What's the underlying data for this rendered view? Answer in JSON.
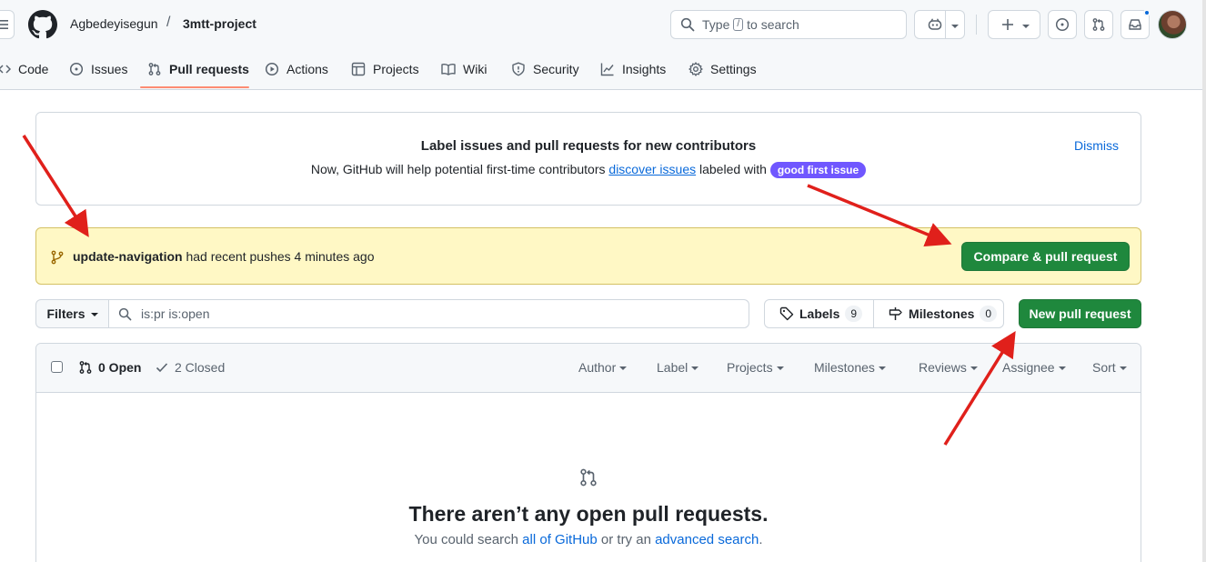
{
  "header": {
    "owner": "Agbedeyisegun",
    "separator": "/",
    "repo": "3mtt-project",
    "search_prefix": "Type",
    "search_key": "/",
    "search_suffix": "to search"
  },
  "nav": {
    "items": [
      {
        "label": "Code",
        "icon": "code-icon"
      },
      {
        "label": "Issues",
        "icon": "issue-opened-icon"
      },
      {
        "label": "Pull requests",
        "icon": "git-pull-request-icon",
        "active": true
      },
      {
        "label": "Actions",
        "icon": "play-icon"
      },
      {
        "label": "Projects",
        "icon": "table-icon"
      },
      {
        "label": "Wiki",
        "icon": "book-icon"
      },
      {
        "label": "Security",
        "icon": "shield-icon"
      },
      {
        "label": "Insights",
        "icon": "graph-icon"
      },
      {
        "label": "Settings",
        "icon": "gear-icon"
      }
    ]
  },
  "contrib_banner": {
    "title": "Label issues and pull requests for new contributors",
    "text_before": "Now, GitHub will help potential first-time contributors",
    "link": "discover issues",
    "text_after": "labeled with",
    "label": "good first issue",
    "label_color": "#7057ff",
    "dismiss": "Dismiss"
  },
  "push_banner": {
    "branch": "update-navigation",
    "text": "had recent pushes 4 minutes ago",
    "compare_button": "Compare & pull request"
  },
  "toolbar": {
    "filters": "Filters",
    "query": "is:pr is:open",
    "labels": "Labels",
    "labels_count": "9",
    "milestones": "Milestones",
    "milestones_count": "0",
    "new_pr": "New pull request"
  },
  "list": {
    "open": "0 Open",
    "closed": "2 Closed",
    "filters": [
      "Author",
      "Label",
      "Projects",
      "Milestones",
      "Reviews",
      "Assignee",
      "Sort"
    ],
    "empty_title": "There aren’t any open pull requests.",
    "empty_before": "You could search",
    "empty_link1": "all of GitHub",
    "empty_middle": "or try an",
    "empty_link2": "advanced search",
    "empty_end": "."
  },
  "colors": {
    "accent": "#0969da",
    "primary_button": "#1f883d",
    "active_tab_underline": "#fd8c73",
    "annotation_arrow": "#e0201b"
  }
}
